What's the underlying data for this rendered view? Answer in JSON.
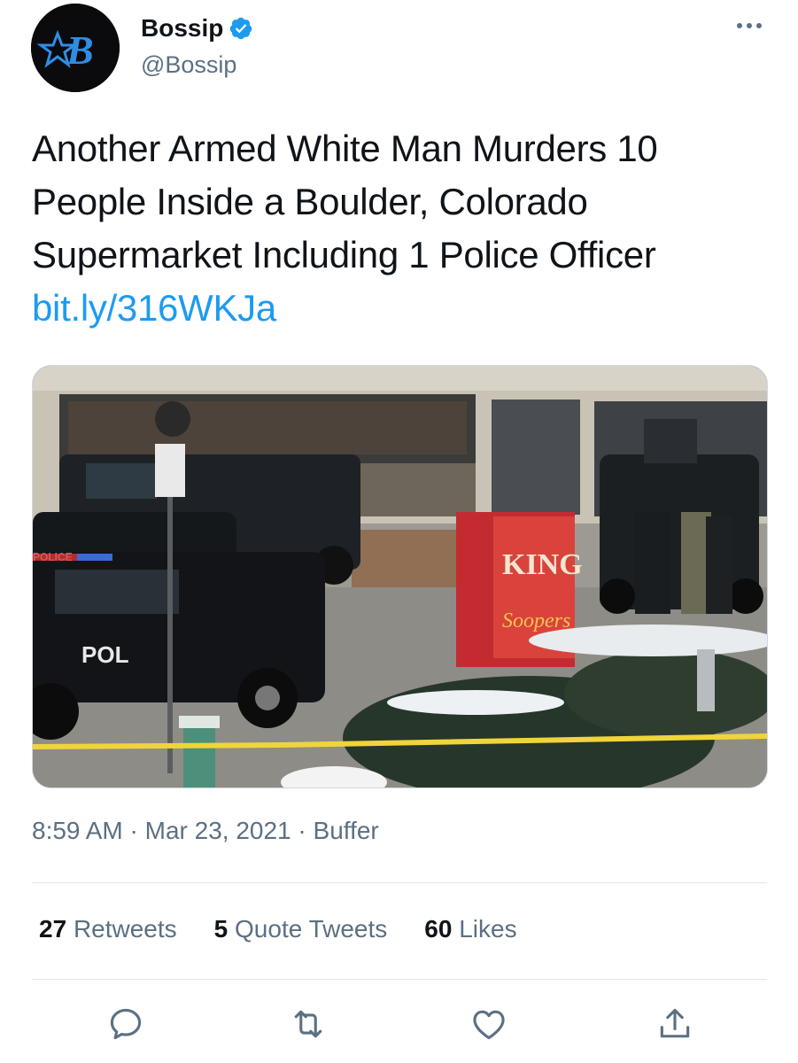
{
  "author": {
    "display_name": "Bossip",
    "handle": "@Bossip",
    "verified": true,
    "avatar_letter": "B"
  },
  "tweet": {
    "text_line1": "Another Armed White Man Murders 10",
    "text_line2": "People Inside a Boulder, Colorado",
    "text_line3": "Supermarket Including 1 Police Officer",
    "link": "bit.ly/316WKJa"
  },
  "media": {
    "description_icon": "photo",
    "sign_text_1": "KING",
    "sign_text_2": "Soopers",
    "vehicle_text_1": "POL",
    "vehicle_text_2": "POLICE"
  },
  "meta": {
    "time": "8:59 AM",
    "separator": "·",
    "date": "Mar 23, 2021",
    "source": "Buffer"
  },
  "stats": {
    "retweets_count": "27",
    "retweets_label": "Retweets",
    "quotes_count": "5",
    "quotes_label": "Quote Tweets",
    "likes_count": "60",
    "likes_label": "Likes"
  },
  "colors": {
    "link": "#1d9bf0",
    "secondary_text": "#5b7083",
    "verified_badge": "#1d9bf0"
  }
}
